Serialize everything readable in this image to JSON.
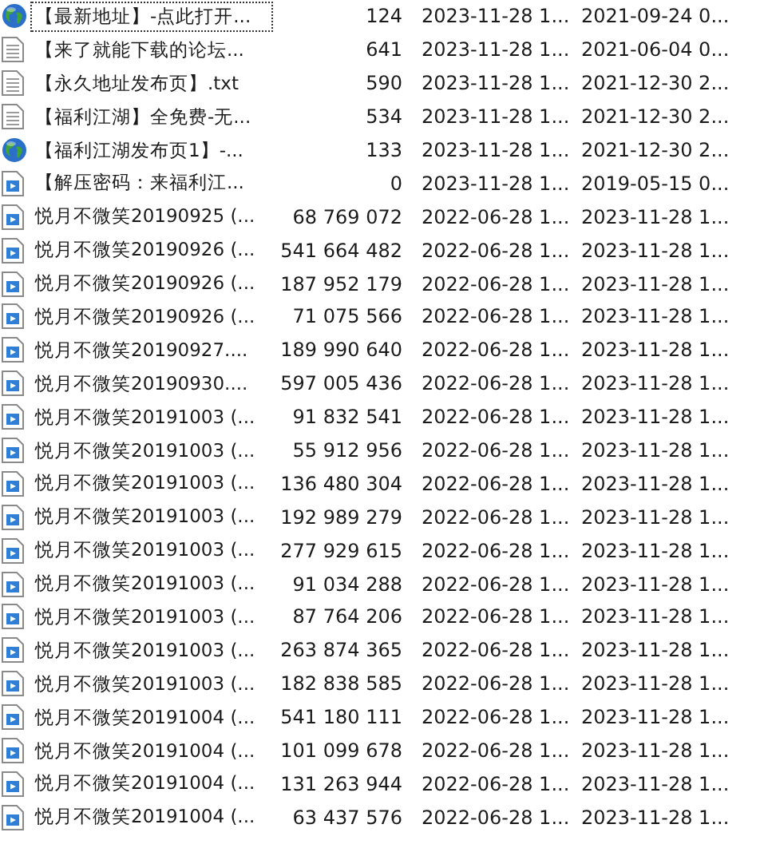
{
  "files": [
    {
      "kind": "globe",
      "name": "【最新地址】-点此打开...",
      "size": "124",
      "modified": "2023-11-28 1...",
      "created": "2021-09-24 0...",
      "focused": true
    },
    {
      "kind": "text",
      "name": "【来了就能下载的论坛...",
      "size": "641",
      "modified": "2023-11-28 1...",
      "created": "2021-06-04 0...",
      "focused": false
    },
    {
      "kind": "text",
      "name": "【永久地址发布页】.txt",
      "size": "590",
      "modified": "2023-11-28 1...",
      "created": "2021-12-30 2...",
      "focused": false
    },
    {
      "kind": "text",
      "name": "【福利江湖】全免费-无...",
      "size": "534",
      "modified": "2023-11-28 1...",
      "created": "2021-12-30 2...",
      "focused": false
    },
    {
      "kind": "globe",
      "name": "【福利江湖发布页1】-...",
      "size": "133",
      "modified": "2023-11-28 1...",
      "created": "2021-12-30 2...",
      "focused": false
    },
    {
      "kind": "media",
      "name": "【解压密码：来福利江...",
      "size": "0",
      "modified": "2023-11-28 1...",
      "created": "2019-05-15 0...",
      "focused": false
    },
    {
      "kind": "media",
      "name": "悦月不微笑20190925 (...",
      "size": "68 769 072",
      "modified": "2022-06-28 1...",
      "created": "2023-11-28 1...",
      "focused": false
    },
    {
      "kind": "media",
      "name": "悦月不微笑20190926 (...",
      "size": "541 664 482",
      "modified": "2022-06-28 1...",
      "created": "2023-11-28 1...",
      "focused": false
    },
    {
      "kind": "media",
      "name": "悦月不微笑20190926 (...",
      "size": "187 952 179",
      "modified": "2022-06-28 1...",
      "created": "2023-11-28 1...",
      "focused": false
    },
    {
      "kind": "media",
      "name": "悦月不微笑20190926 (...",
      "size": "71 075 566",
      "modified": "2022-06-28 1...",
      "created": "2023-11-28 1...",
      "focused": false
    },
    {
      "kind": "media",
      "name": "悦月不微笑20190927....",
      "size": "189 990 640",
      "modified": "2022-06-28 1...",
      "created": "2023-11-28 1...",
      "focused": false
    },
    {
      "kind": "media",
      "name": "悦月不微笑20190930....",
      "size": "597 005 436",
      "modified": "2022-06-28 1...",
      "created": "2023-11-28 1...",
      "focused": false
    },
    {
      "kind": "media",
      "name": "悦月不微笑20191003 (...",
      "size": "91 832 541",
      "modified": "2022-06-28 1...",
      "created": "2023-11-28 1...",
      "focused": false
    },
    {
      "kind": "media",
      "name": "悦月不微笑20191003 (...",
      "size": "55 912 956",
      "modified": "2022-06-28 1...",
      "created": "2023-11-28 1...",
      "focused": false
    },
    {
      "kind": "media",
      "name": "悦月不微笑20191003 (...",
      "size": "136 480 304",
      "modified": "2022-06-28 1...",
      "created": "2023-11-28 1...",
      "focused": false
    },
    {
      "kind": "media",
      "name": "悦月不微笑20191003 (...",
      "size": "192 989 279",
      "modified": "2022-06-28 1...",
      "created": "2023-11-28 1...",
      "focused": false
    },
    {
      "kind": "media",
      "name": "悦月不微笑20191003 (...",
      "size": "277 929 615",
      "modified": "2022-06-28 1...",
      "created": "2023-11-28 1...",
      "focused": false
    },
    {
      "kind": "media",
      "name": "悦月不微笑20191003 (...",
      "size": "91 034 288",
      "modified": "2022-06-28 1...",
      "created": "2023-11-28 1...",
      "focused": false
    },
    {
      "kind": "media",
      "name": "悦月不微笑20191003 (...",
      "size": "87 764 206",
      "modified": "2022-06-28 1...",
      "created": "2023-11-28 1...",
      "focused": false
    },
    {
      "kind": "media",
      "name": "悦月不微笑20191003 (...",
      "size": "263 874 365",
      "modified": "2022-06-28 1...",
      "created": "2023-11-28 1...",
      "focused": false
    },
    {
      "kind": "media",
      "name": "悦月不微笑20191003 (...",
      "size": "182 838 585",
      "modified": "2022-06-28 1...",
      "created": "2023-11-28 1...",
      "focused": false
    },
    {
      "kind": "media",
      "name": "悦月不微笑20191004 (...",
      "size": "541 180 111",
      "modified": "2022-06-28 1...",
      "created": "2023-11-28 1...",
      "focused": false
    },
    {
      "kind": "media",
      "name": "悦月不微笑20191004 (...",
      "size": "101 099 678",
      "modified": "2022-06-28 1...",
      "created": "2023-11-28 1...",
      "focused": false
    },
    {
      "kind": "media",
      "name": "悦月不微笑20191004 (...",
      "size": "131 263 944",
      "modified": "2022-06-28 1...",
      "created": "2023-11-28 1...",
      "focused": false
    },
    {
      "kind": "media",
      "name": "悦月不微笑20191004 (...",
      "size": "63 437 576",
      "modified": "2022-06-28 1...",
      "created": "2023-11-28 1...",
      "focused": false
    }
  ]
}
